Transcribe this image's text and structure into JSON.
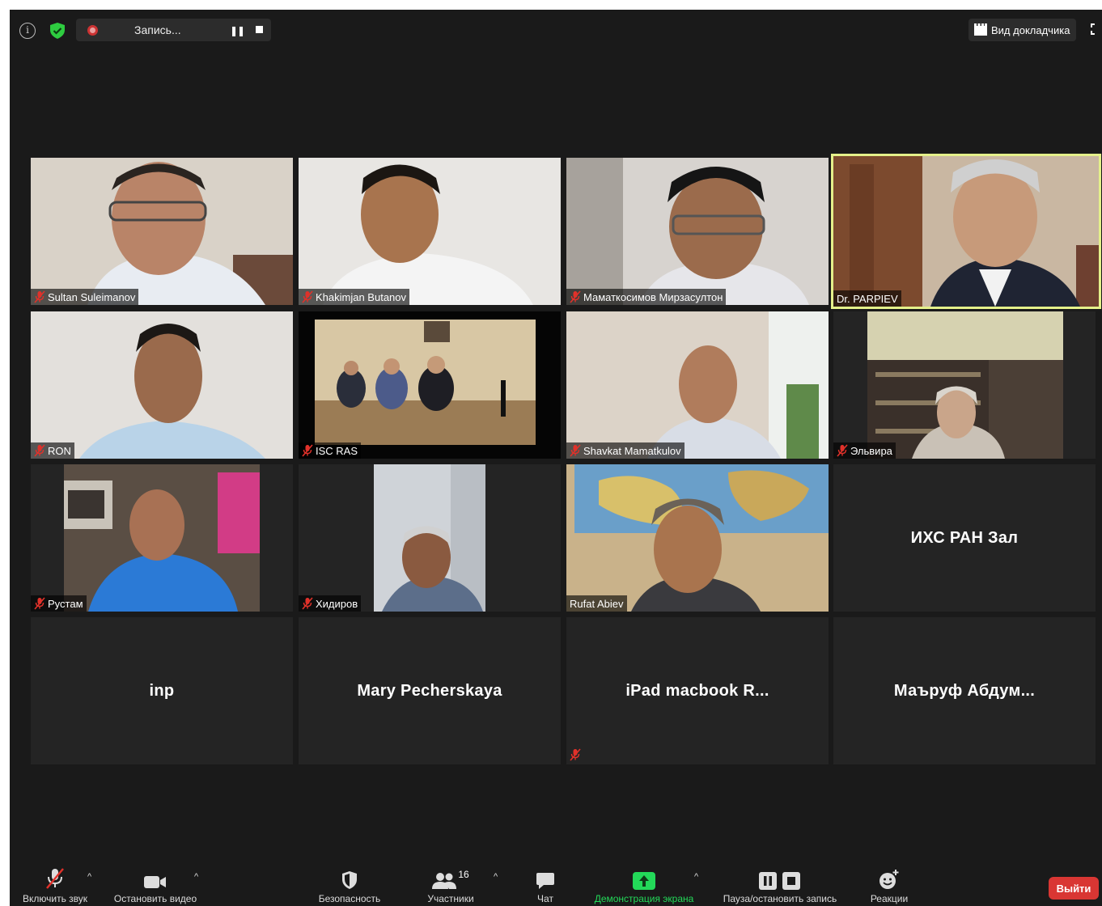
{
  "topbar": {
    "recording_label": "Запись...",
    "speaker_view_label": "Вид докладчика"
  },
  "participants": [
    {
      "name": "Sultan Suleimanov",
      "muted": true
    },
    {
      "name": "Khakimjan Butanov",
      "muted": true
    },
    {
      "name": "Маматкосимов Мирзасултон",
      "muted": true
    },
    {
      "name": "Dr. PARPIEV",
      "muted": false,
      "active_speaker": true
    },
    {
      "name": "RON",
      "muted": true
    },
    {
      "name": "ISC RAS",
      "muted": true
    },
    {
      "name": "Shavkat Mamatkulov",
      "muted": true
    },
    {
      "name": "Эльвира",
      "muted": true
    },
    {
      "name": "Рустам",
      "muted": true
    },
    {
      "name": "Хидиров",
      "muted": true
    },
    {
      "name": "Rufat Abiev",
      "muted": false
    },
    {
      "name": "ИХС РАН Зал",
      "muted": false
    },
    {
      "name": "inp",
      "muted": false
    },
    {
      "name": "Mary Pecherskaya",
      "muted": false
    },
    {
      "name": "iPad macbook R...",
      "muted": true
    },
    {
      "name": "Маъруф Абдум...",
      "muted": false
    }
  ],
  "toolbar": {
    "unmute_label": "Включить звук",
    "stop_video_label": "Остановить видео",
    "security_label": "Безопасность",
    "participants_label": "Участники",
    "participants_count": "16",
    "chat_label": "Чат",
    "share_screen_label": "Демонстрация экрана",
    "record_label": "Пауза/остановить запись",
    "reactions_label": "Реакции",
    "leave_label": "Выйти"
  },
  "colors": {
    "background": "#1a1a1a",
    "tile": "#242424",
    "active_border": "#e4f08a",
    "mute_red": "#e0312a",
    "share_green": "#23d959",
    "leave_red": "#d93633"
  }
}
